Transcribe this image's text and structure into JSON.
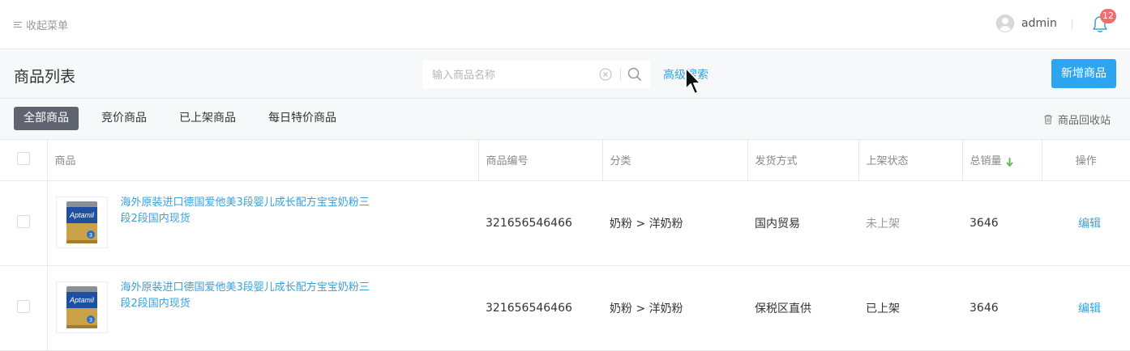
{
  "topbar": {
    "collapse_label": "收起菜单",
    "username": "admin",
    "notification_count": "12"
  },
  "header": {
    "title": "商品列表",
    "search_placeholder": "输入商品名称",
    "advanced_search": "高级搜索",
    "new_button": "新增商品"
  },
  "tabs": [
    {
      "label": "全部商品",
      "active": true
    },
    {
      "label": "竞价商品",
      "active": false
    },
    {
      "label": "已上架商品",
      "active": false
    },
    {
      "label": "每日特价商品",
      "active": false
    }
  ],
  "recycle_label": "商品回收站",
  "table": {
    "columns": [
      "商品",
      "商品编号",
      "分类",
      "发货方式",
      "上架状态",
      "总销量",
      "操作"
    ],
    "rows": [
      {
        "name": "海外原装进口德国爱他美3段婴儿成长配方宝宝奶粉三段2段国内现货",
        "code": "321656546466",
        "category": "奶粉 > 洋奶粉",
        "shipping": "国内贸易",
        "status": "未上架",
        "sales": "3646",
        "action": "编辑"
      },
      {
        "name": "海外原装进口德国爱他美3段婴儿成长配方宝宝奶粉三段2段国内现货",
        "code": "321656546466",
        "category": "奶粉 > 洋奶粉",
        "shipping": "保税区直供",
        "status": "已上架",
        "sales": "3646",
        "action": "编辑"
      }
    ]
  },
  "product_brand": "Aptamil",
  "colors": {
    "accent": "#2ea6ef",
    "link": "#3aa0d8",
    "badge": "#f56c6c",
    "active_tab": "#606470",
    "sort_arrow": "#5cb85c"
  }
}
